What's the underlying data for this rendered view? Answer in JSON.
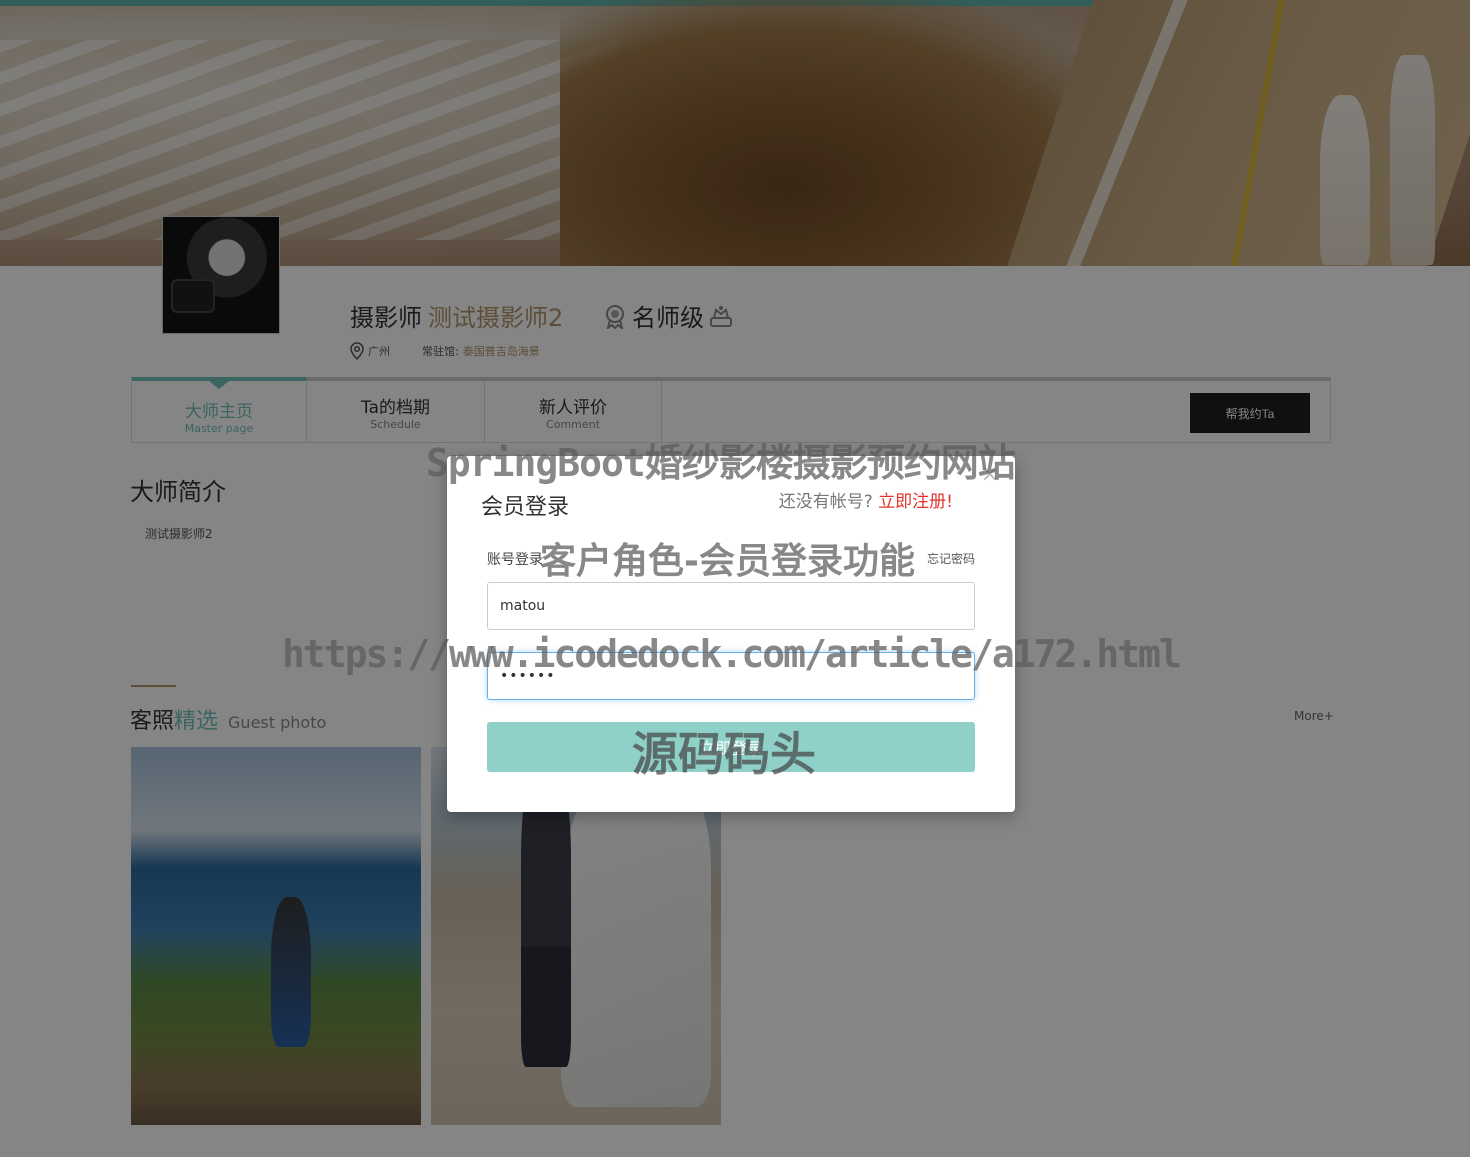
{
  "profile": {
    "prefix": "摄影师",
    "name": "测试摄影师2",
    "rank": "名师级",
    "city": "广州",
    "studio_label": "常驻馆:",
    "studio": "泰国普吉岛海景"
  },
  "tabs": [
    {
      "cn": "大师主页",
      "en": "Master page"
    },
    {
      "cn": "Ta的档期",
      "en": "Schedule"
    },
    {
      "cn": "新人评价",
      "en": "Comment"
    }
  ],
  "book_button": "帮我约Ta",
  "intro": {
    "title": "大师简介",
    "text": "测试摄影师2"
  },
  "guest": {
    "title_a": "客照",
    "title_b": "精选",
    "title_en": "Guest photo",
    "more": "More+"
  },
  "modal": {
    "close": "×",
    "title": "会员登录",
    "no_account": "还没有帐号?",
    "register": "立即注册!",
    "tab": "账号登录",
    "forgot": "忘记密码",
    "username": "matou",
    "password": "••••••",
    "submit": "立即登录"
  },
  "watermarks": {
    "line1": "SpringBoot婚纱影楼摄影预约网站",
    "line2": "客户角色-会员登录功能",
    "line3": "https://www.icodedock.com/article/a172.html",
    "line4": "源码码头"
  },
  "colors": {
    "accent": "#6fc1b8",
    "gold": "#b4946a",
    "register_red": "#e0342d"
  }
}
